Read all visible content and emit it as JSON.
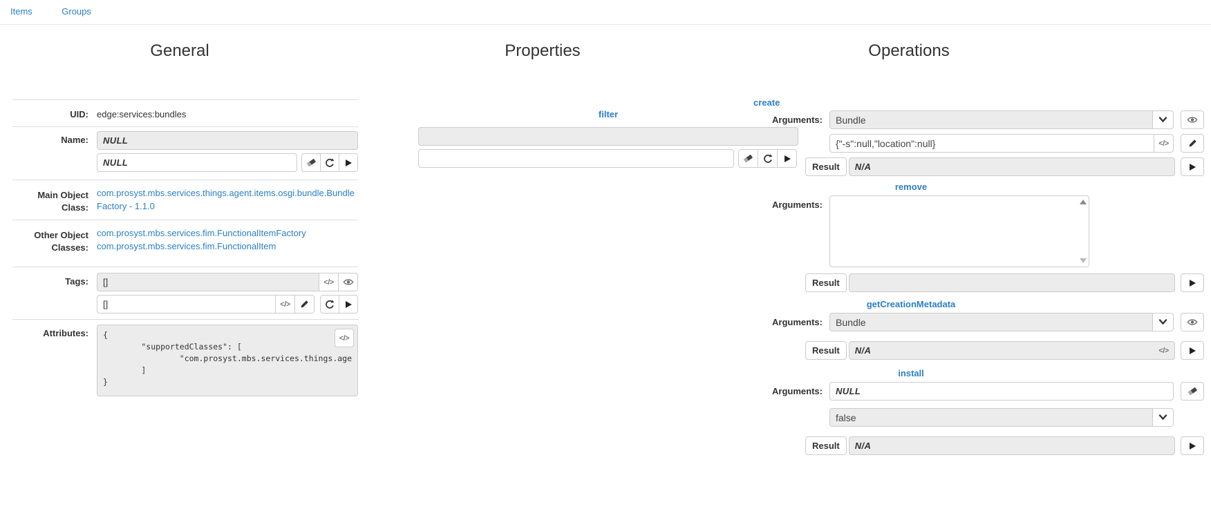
{
  "nav": {
    "tabs": [
      {
        "label": "Items"
      },
      {
        "label": "Groups"
      }
    ]
  },
  "sections": {
    "general_title": "General",
    "properties_title": "Properties",
    "operations_title": "Operations"
  },
  "general": {
    "uid_label": "UID:",
    "uid_value": "edge:services:bundles",
    "name_label": "Name:",
    "name_value": "NULL",
    "name_edit_value": "NULL",
    "main_object_class_label": "Main Object Class:",
    "main_object_class_link": "com.prosyst.mbs.services.things.agent.items.osgi.bundle.BundleFactory - 1.1.0",
    "other_object_classes_label": "Other Object Classes:",
    "other_object_class_links": [
      "com.prosyst.mbs.services.fim.FunctionalItemFactory",
      "com.prosyst.mbs.services.fim.FunctionalItem"
    ],
    "tags_label": "Tags:",
    "tags_value": "[]",
    "tags_edit_value": "[]",
    "attributes_label": "Attributes:",
    "attributes_json": "{\n        \"supportedClasses\": [\n                \"com.prosyst.mbs.services.things.age\n        ]\n}"
  },
  "properties": {
    "filter_link": "filter",
    "filter_value": "",
    "filter_edit_value": ""
  },
  "operations": {
    "arguments_label": "Arguments:",
    "result_label": "Result",
    "create": {
      "link": "create",
      "type_value": "Bundle",
      "args_value": "{\"-s\":null,\"location\":null}",
      "result_value": "N/A"
    },
    "remove": {
      "link": "remove",
      "args_value": "",
      "result_value": ""
    },
    "getCreationMetadata": {
      "link": "getCreationMetadata",
      "type_value": "Bundle",
      "result_value": "N/A"
    },
    "install": {
      "link": "install",
      "args_value": "NULL",
      "flag_value": "false",
      "result_value": "N/A"
    }
  },
  "icons": {
    "code_label": "</>"
  },
  "colors": {
    "link_blue": "#2b7fc6",
    "label_text": "#333333",
    "readonly_bg": "#ececec",
    "border": "#cccccc",
    "divider": "#dddddd"
  }
}
